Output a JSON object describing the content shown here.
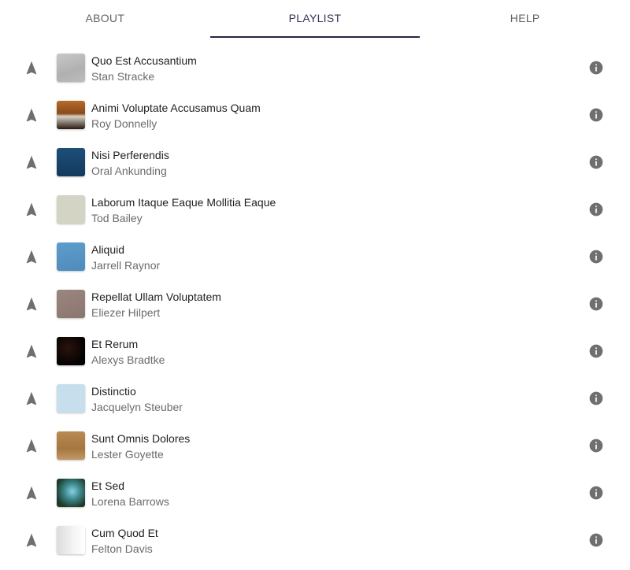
{
  "tabs": [
    {
      "label": "ABOUT",
      "active": false
    },
    {
      "label": "PLAYLIST",
      "active": true
    },
    {
      "label": "HELP",
      "active": false
    }
  ],
  "playlist": [
    {
      "title": "Quo Est Accusantium",
      "artist": "Stan Stracke"
    },
    {
      "title": "Animi Voluptate Accusamus Quam",
      "artist": "Roy Donnelly"
    },
    {
      "title": "Nisi Perferendis",
      "artist": "Oral Ankunding"
    },
    {
      "title": "Laborum Itaque Eaque Mollitia Eaque",
      "artist": "Tod Bailey"
    },
    {
      "title": "Aliquid",
      "artist": "Jarrell Raynor"
    },
    {
      "title": "Repellat Ullam Voluptatem",
      "artist": "Eliezer Hilpert"
    },
    {
      "title": "Et Rerum",
      "artist": "Alexys Bradtke"
    },
    {
      "title": "Distinctio",
      "artist": "Jacquelyn Steuber"
    },
    {
      "title": "Sunt Omnis Dolores",
      "artist": "Lester Goyette"
    },
    {
      "title": "Et Sed",
      "artist": "Lorena Barrows"
    },
    {
      "title": "Cum Quod Et",
      "artist": "Felton Davis"
    }
  ],
  "icons": {
    "row_action": "navigation-arrow-icon",
    "row_info": "info-icon"
  },
  "colors": {
    "active_tab_indicator": "#2e2145",
    "icon_gray": "#6f6f6f"
  }
}
